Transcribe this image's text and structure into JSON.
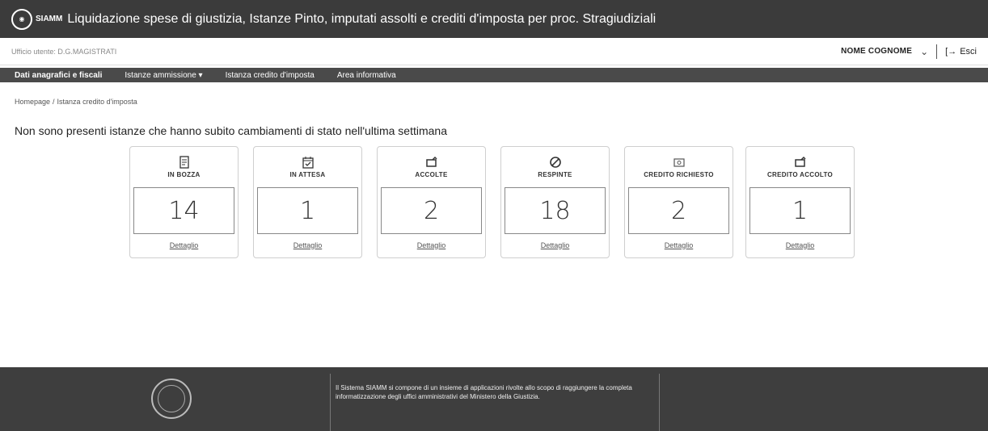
{
  "header": {
    "logo_text": "SIAMM",
    "title": "Liquidazione spese di giustizia, Istanze Pinto, imputati assolti e crediti d'imposta per proc. Stragiudiziali"
  },
  "subheader": {
    "office": "Ufficio utente: D.G.MAGISTRATI",
    "user_name": "NOME COGNOME",
    "logout_label": "Esci"
  },
  "nav": {
    "items": [
      {
        "label": "Dati anagrafici e fiscali"
      },
      {
        "label": "Istanze ammissione ▾"
      },
      {
        "label": "Istanza credito d'imposta"
      },
      {
        "label": "Area informativa"
      }
    ]
  },
  "breadcrumb": {
    "home": "Homepage",
    "current": "Istanza credito d'imposta"
  },
  "page": {
    "heading": "Non sono presenti istanze che hanno subito cambiamenti di stato nell'ultima settimana"
  },
  "cards": [
    {
      "label": "IN BOZZA",
      "value": "14",
      "link": "Dettaglio",
      "icon": "draft-icon"
    },
    {
      "label": "IN ATTESA",
      "value": "1",
      "link": "Dettaglio",
      "icon": "calendar-check-icon"
    },
    {
      "label": "ACCOLTE",
      "value": "2",
      "link": "Dettaglio",
      "icon": "approved-icon"
    },
    {
      "label": "RESPINTE",
      "value": "18",
      "link": "Dettaglio",
      "icon": "rejected-icon"
    },
    {
      "label": "CREDITO RICHIESTO",
      "value": "2",
      "link": "Dettaglio",
      "icon": "credit-requested-icon"
    },
    {
      "label": "CREDITO ACCOLTO",
      "value": "1",
      "link": "Dettaglio",
      "icon": "credit-approved-icon"
    }
  ],
  "footer": {
    "description": "Il Sistema SIAMM si compone di un insieme di applicazioni rivolte allo scopo di raggiungere la completa informatizzazione degli uffici amministrativi del Ministero della Giustizia."
  },
  "colors": {
    "header_bg": "#3b3b3b",
    "nav_bg": "#4a4a4a",
    "footer_bg": "#3e3e3e"
  }
}
